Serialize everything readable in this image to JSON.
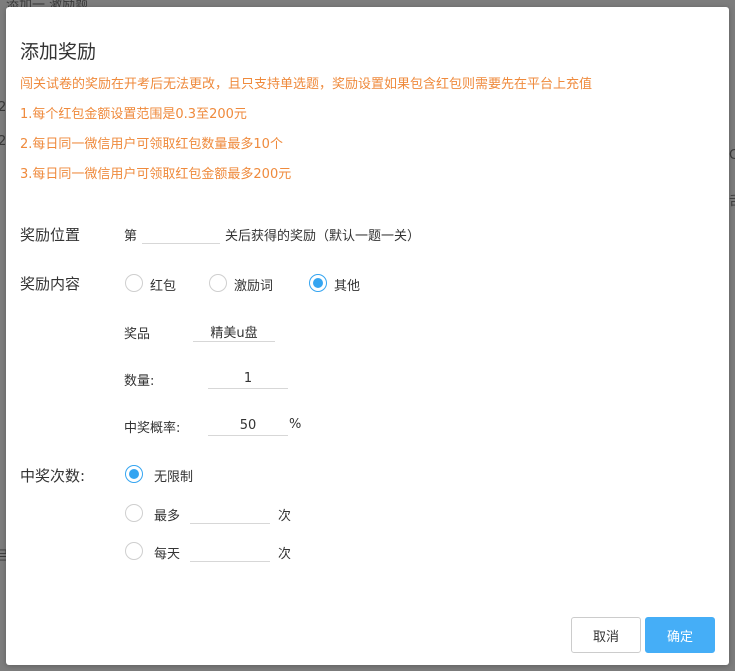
{
  "background": {
    "frag_top": "添加一 激励题",
    "frag_left_1": "2",
    "frag_left_2": "2",
    "frag_left_3": "吕",
    "frag_right_1": "C",
    "frag_right_2": "舌"
  },
  "dialog": {
    "title": "添加奖励",
    "notices": [
      "闯关试卷的奖励在开考后无法更改，且只支持单选题，奖励设置如果包含红包则需要先在平台上充值",
      "1.每个红包金额设置范围是0.3至200元",
      "2.每日同一微信用户可领取红包数量最多10个",
      "3.每日同一微信用户可领取红包金额最多200元"
    ],
    "reward_position": {
      "label": "奖励位置",
      "prefix": "第",
      "value": "",
      "suffix": "关后获得的奖励（默认一题一关）"
    },
    "reward_content": {
      "label": "奖励内容",
      "options": [
        "红包",
        "激励词",
        "其他"
      ],
      "selected": "其他"
    },
    "prize": {
      "label": "奖品",
      "value": "精美u盘"
    },
    "quantity": {
      "label": "数量:",
      "value": "1"
    },
    "probability": {
      "label": "中奖概率:",
      "value": "50",
      "unit": "%"
    },
    "win_times": {
      "label": "中奖次数:",
      "unlimited": "无限制",
      "max_label": "最多",
      "max_value": "",
      "max_unit": "次",
      "daily_label": "每天",
      "daily_value": "",
      "daily_unit": "次",
      "selected": "无限制"
    },
    "buttons": {
      "cancel": "取消",
      "ok": "确定"
    }
  },
  "colors": {
    "accent": "#35a5f1",
    "notice": "#ef8a3c",
    "button_primary": "#45aef7"
  }
}
